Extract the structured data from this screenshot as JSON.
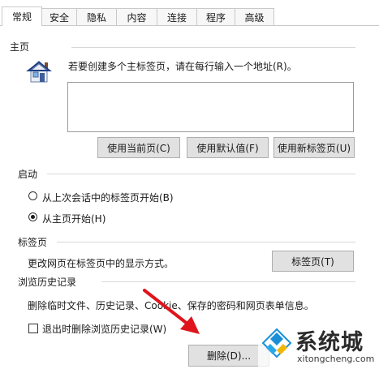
{
  "tabs": [
    {
      "label": "常规"
    },
    {
      "label": "安全"
    },
    {
      "label": "隐私"
    },
    {
      "label": "内容"
    },
    {
      "label": "连接"
    },
    {
      "label": "程序"
    },
    {
      "label": "高级"
    }
  ],
  "homepage": {
    "group_label": "主页",
    "description": "若要创建多个主标签页，请在每行输入一个地址(R)。",
    "url_value": "",
    "use_current": "使用当前页(C)",
    "use_default": "使用默认值(F)",
    "use_new_tab": "使用新标签页(U)"
  },
  "startup": {
    "group_label": "启动",
    "option_last_session": "从上次会话中的标签页开始(B)",
    "option_home": "从主页开始(H)",
    "selected": "home"
  },
  "tabs_section": {
    "group_label": "标签页",
    "description": "更改网页在标签页中的显示方式。",
    "button": "标签页(T)"
  },
  "history": {
    "group_label": "浏览历史记录",
    "description": "删除临时文件、历史记录、Cookie、保存的密码和网页表单信息。",
    "checkbox_label": "退出时删除浏览历史记录(W)",
    "checkbox_checked": false,
    "delete_button": "删除(D)..."
  },
  "watermark": {
    "brand": "系统城",
    "domain": "xitongcheng.com"
  },
  "colors": {
    "arrow": "#e0141b",
    "button_bg": "#e1e1e1",
    "logo_blue": "#1a8fd8"
  }
}
